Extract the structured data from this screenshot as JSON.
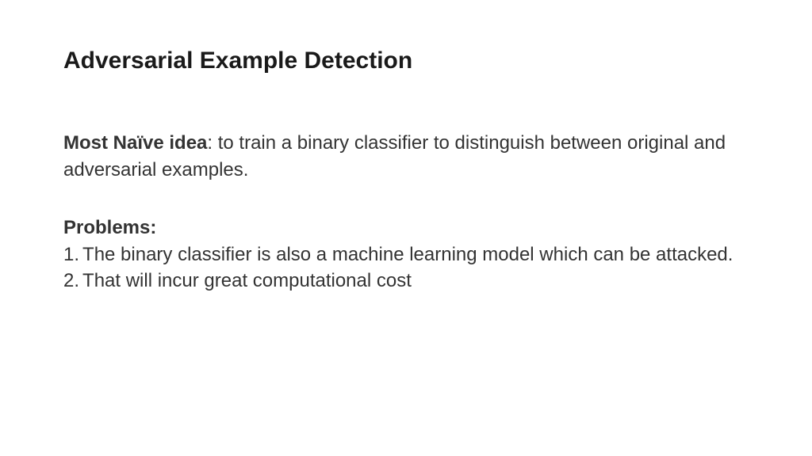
{
  "title": "Adversarial Example Detection",
  "idea": {
    "label": "Most Naïve idea",
    "text": ": to train a binary classifier to distinguish between original and adversarial examples."
  },
  "problems": {
    "label": "Problems:",
    "items": [
      "The binary classifier is also a machine learning model which can be attacked.",
      "That will incur great computational cost"
    ]
  }
}
